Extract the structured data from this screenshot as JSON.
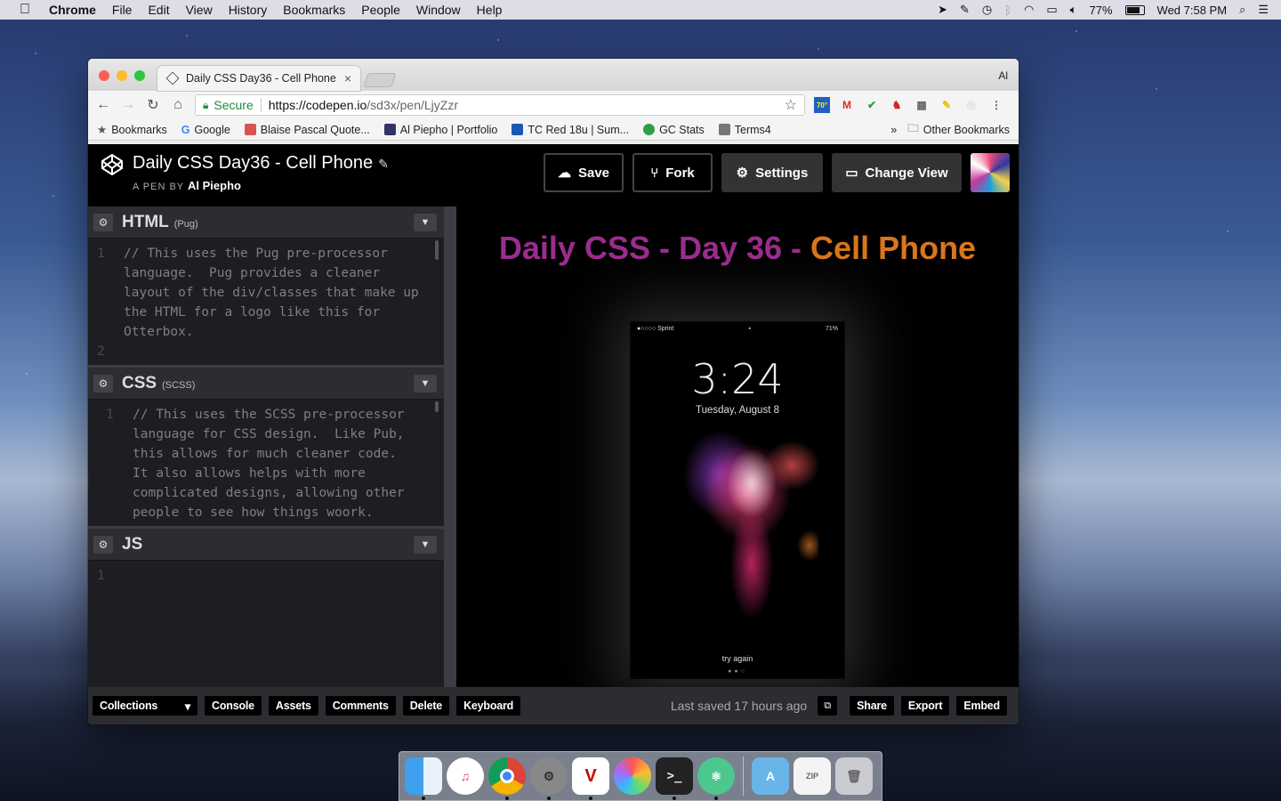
{
  "menubar": {
    "app": "Chrome",
    "items": [
      "File",
      "Edit",
      "View",
      "History",
      "Bookmarks",
      "People",
      "Window",
      "Help"
    ],
    "battery": "77%",
    "clock": "Wed 7:58 PM"
  },
  "browser": {
    "tab_title": "Daily CSS Day36 - Cell Phone",
    "tab_close": "×",
    "profile": "Al",
    "secure_label": "Secure",
    "url_host": "https://codepen.io",
    "url_path": "/sd3x/pen/LjyZzr",
    "ext_temp": "70°",
    "bookmarks": [
      {
        "label": "Bookmarks",
        "color": "#555555"
      },
      {
        "label": "Google",
        "color": "#4285f4"
      },
      {
        "label": "Blaise Pascal Quote...",
        "color": "#d9534f"
      },
      {
        "label": "Al Piepho | Portfolio",
        "color": "#333366"
      },
      {
        "label": "TC Red 18u | Sum...",
        "color": "#1a57b5"
      },
      {
        "label": "GC Stats",
        "color": "#2f9e44"
      },
      {
        "label": "Terms4",
        "color": "#777777"
      }
    ],
    "bookmarks_more": "»",
    "other_bookmarks": "Other Bookmarks"
  },
  "pen": {
    "title": "Daily CSS Day36 - Cell Phone",
    "by_prefix": "A PEN BY",
    "author": "Al Piepho",
    "buttons": {
      "save": "Save",
      "fork": "Fork",
      "settings": "Settings",
      "change_view": "Change View"
    }
  },
  "editors": {
    "html": {
      "lang": "HTML",
      "sub": "(Pug)",
      "line1": "1",
      "line2": "2",
      "code1": "// This uses the Pug pre-processor\nlanguage.  Pug provides a cleaner\nlayout of the div/classes that make up\nthe HTML for a logo like this for\nOtterbox."
    },
    "css": {
      "lang": "CSS",
      "sub": "(SCSS)",
      "line1": "1",
      "code1": "// This uses the SCSS pre-processor\nlanguage for CSS design.  Like Pub,\nthis allows for much cleaner code.\nIt also allows helps with more\ncomplicated designs, allowing other\npeople to see how things woork."
    },
    "js": {
      "lang": "JS",
      "line1": "1"
    }
  },
  "preview": {
    "title_part1": "Daily CSS - Day 36 - ",
    "title_part2": "Cell Phone",
    "phone": {
      "carrier": "●○○○○ Sprint",
      "battery": "71%",
      "time": "3:24",
      "date": "Tuesday, August 8",
      "prompt": "try again",
      "page_dots": "●●○"
    }
  },
  "footer": {
    "collections": "Collections",
    "console": "Console",
    "assets": "Assets",
    "comments": "Comments",
    "delete": "Delete",
    "keyboard": "Keyboard",
    "last_saved": "Last saved 17 hours ago",
    "share": "Share",
    "export": "Export",
    "embed": "Embed"
  },
  "dock": {
    "apps": [
      "Finder",
      "iTunes",
      "Chrome",
      "System Preferences",
      "VS Code",
      "Photos",
      "Terminal",
      "Atom",
      "Applications",
      "Archive",
      "Trash"
    ]
  }
}
